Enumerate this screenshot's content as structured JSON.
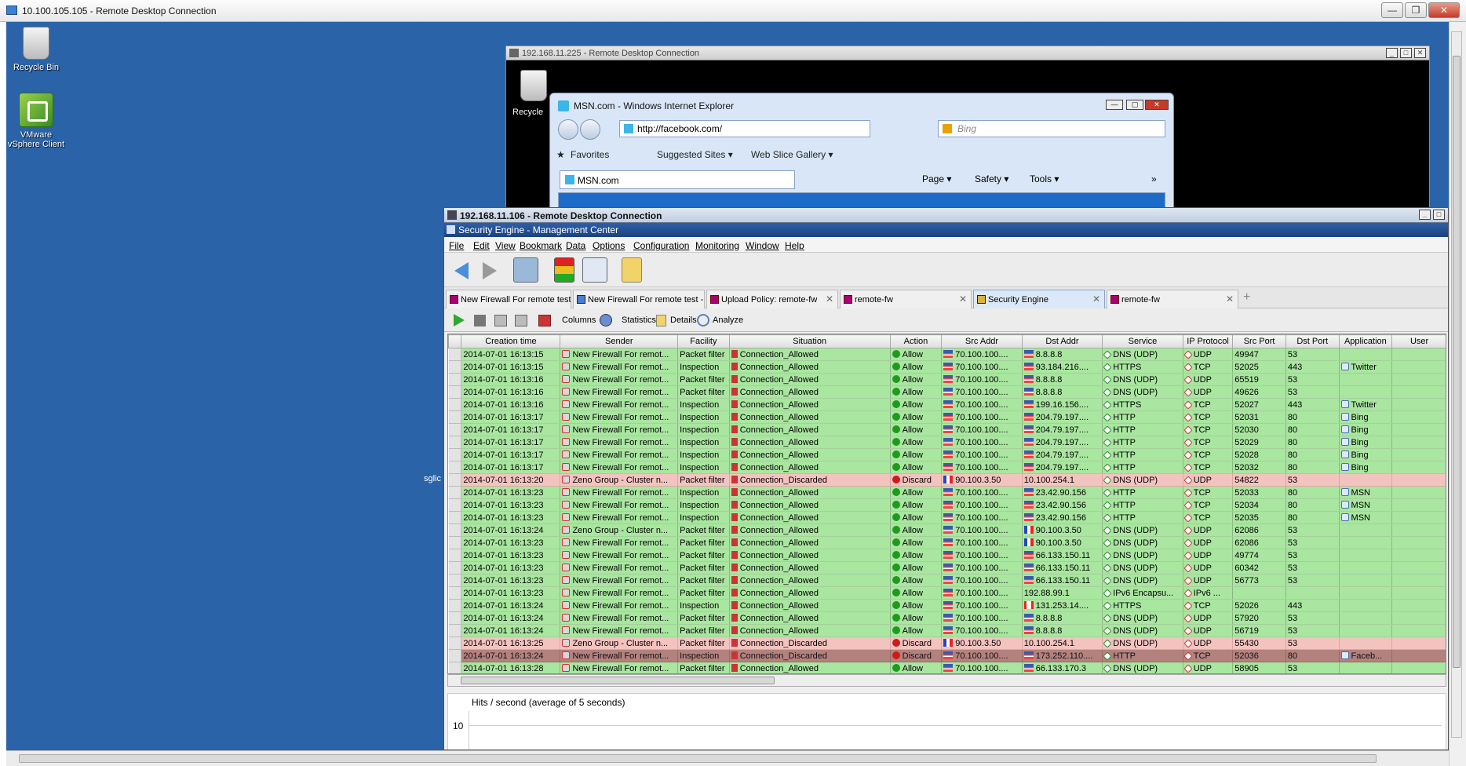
{
  "outer": {
    "title": "10.100.105.105 - Remote Desktop Connection",
    "min": "—",
    "max": "❐",
    "close": "✕"
  },
  "desktop": {
    "icons": [
      {
        "label": "Recycle Bin"
      },
      {
        "label": "VMware vSphere Client"
      }
    ],
    "sglic": "sglic"
  },
  "rdp2": {
    "title": "192.168.11.225 - Remote Desktop Connection",
    "recycle_label": "Recycle"
  },
  "ie": {
    "title": "MSN.com - Windows Internet Explorer",
    "address": "http://facebook.com/",
    "search_placeholder": "Bing",
    "favorites": "Favorites",
    "suggested": "Suggested Sites ▾",
    "webslice": "Web Slice Gallery ▾",
    "tab": "MSN.com",
    "page_menu": "Page ▾",
    "safety_menu": "Safety ▾",
    "tools_menu": "Tools ▾",
    "chevron": "»"
  },
  "rdp3": {
    "title": "192.168.11.106 - Remote Desktop Connection"
  },
  "sem": {
    "title": "Security Engine - Management Center",
    "menus": [
      "File",
      "Edit",
      "View",
      "Bookmark",
      "Data",
      "Options",
      "Configuration",
      "Monitoring",
      "Window",
      "Help"
    ],
    "tabs": [
      {
        "label": "New Firewall For remote test"
      },
      {
        "label": "New Firewall For remote test - ..."
      },
      {
        "label": "Upload Policy: remote-fw"
      },
      {
        "label": "remote-fw"
      },
      {
        "label": "Security Engine"
      },
      {
        "label": "remote-fw"
      }
    ],
    "add_tab": "+",
    "subtools": {
      "columns": "Columns",
      "statistics": "Statistics",
      "details": "Details",
      "analyze": "Analyze"
    },
    "columns": [
      "Creation time",
      "Sender",
      "Facility",
      "Situation",
      "Action",
      "Src Addr",
      "Dst Addr",
      "Service",
      "IP Protocol",
      "Src Port",
      "Dst Port",
      "Application",
      "User"
    ],
    "rows": [
      {
        "type": "allow",
        "time": "2014-07-01 16:13:15",
        "sender": "New Firewall For remot...",
        "facility": "Packet filter",
        "situation": "Connection_Allowed",
        "action": "Allow",
        "src": "70.100.100....",
        "src_flag": "us",
        "dst": "8.8.8.8",
        "dst_flag": "us",
        "service": "DNS (UDP)",
        "proto": "UDP",
        "sport": "49947",
        "dport": "53",
        "app": "",
        "user": ""
      },
      {
        "type": "allow",
        "time": "2014-07-01 16:13:15",
        "sender": "New Firewall For remot...",
        "facility": "Inspection",
        "situation": "Connection_Allowed",
        "action": "Allow",
        "src": "70.100.100....",
        "src_flag": "us",
        "dst": "93.184.216....",
        "dst_flag": "us",
        "service": "HTTPS",
        "proto": "TCP",
        "sport": "52025",
        "dport": "443",
        "app": "Twitter",
        "user": ""
      },
      {
        "type": "allow",
        "time": "2014-07-01 16:13:16",
        "sender": "New Firewall For remot...",
        "facility": "Packet filter",
        "situation": "Connection_Allowed",
        "action": "Allow",
        "src": "70.100.100....",
        "src_flag": "us",
        "dst": "8.8.8.8",
        "dst_flag": "us",
        "service": "DNS (UDP)",
        "proto": "UDP",
        "sport": "65519",
        "dport": "53",
        "app": "",
        "user": ""
      },
      {
        "type": "allow",
        "time": "2014-07-01 16:13:16",
        "sender": "New Firewall For remot...",
        "facility": "Packet filter",
        "situation": "Connection_Allowed",
        "action": "Allow",
        "src": "70.100.100....",
        "src_flag": "us",
        "dst": "8.8.8.8",
        "dst_flag": "us",
        "service": "DNS (UDP)",
        "proto": "UDP",
        "sport": "49626",
        "dport": "53",
        "app": "",
        "user": ""
      },
      {
        "type": "allow",
        "time": "2014-07-01 16:13:16",
        "sender": "New Firewall For remot...",
        "facility": "Inspection",
        "situation": "Connection_Allowed",
        "action": "Allow",
        "src": "70.100.100....",
        "src_flag": "us",
        "dst": "199.16.156....",
        "dst_flag": "us",
        "service": "HTTPS",
        "proto": "TCP",
        "sport": "52027",
        "dport": "443",
        "app": "Twitter",
        "user": ""
      },
      {
        "type": "allow",
        "time": "2014-07-01 16:13:17",
        "sender": "New Firewall For remot...",
        "facility": "Inspection",
        "situation": "Connection_Allowed",
        "action": "Allow",
        "src": "70.100.100....",
        "src_flag": "us",
        "dst": "204.79.197....",
        "dst_flag": "us",
        "service": "HTTP",
        "proto": "TCP",
        "sport": "52031",
        "dport": "80",
        "app": "Bing",
        "user": ""
      },
      {
        "type": "allow",
        "time": "2014-07-01 16:13:17",
        "sender": "New Firewall For remot...",
        "facility": "Inspection",
        "situation": "Connection_Allowed",
        "action": "Allow",
        "src": "70.100.100....",
        "src_flag": "us",
        "dst": "204.79.197....",
        "dst_flag": "us",
        "service": "HTTP",
        "proto": "TCP",
        "sport": "52030",
        "dport": "80",
        "app": "Bing",
        "user": ""
      },
      {
        "type": "allow",
        "time": "2014-07-01 16:13:17",
        "sender": "New Firewall For remot...",
        "facility": "Inspection",
        "situation": "Connection_Allowed",
        "action": "Allow",
        "src": "70.100.100....",
        "src_flag": "us",
        "dst": "204.79.197....",
        "dst_flag": "us",
        "service": "HTTP",
        "proto": "TCP",
        "sport": "52029",
        "dport": "80",
        "app": "Bing",
        "user": ""
      },
      {
        "type": "allow",
        "time": "2014-07-01 16:13:17",
        "sender": "New Firewall For remot...",
        "facility": "Inspection",
        "situation": "Connection_Allowed",
        "action": "Allow",
        "src": "70.100.100....",
        "src_flag": "us",
        "dst": "204.79.197....",
        "dst_flag": "us",
        "service": "HTTP",
        "proto": "TCP",
        "sport": "52028",
        "dport": "80",
        "app": "Bing",
        "user": ""
      },
      {
        "type": "allow",
        "time": "2014-07-01 16:13:17",
        "sender": "New Firewall For remot...",
        "facility": "Inspection",
        "situation": "Connection_Allowed",
        "action": "Allow",
        "src": "70.100.100....",
        "src_flag": "us",
        "dst": "204.79.197....",
        "dst_flag": "us",
        "service": "HTTP",
        "proto": "TCP",
        "sport": "52032",
        "dport": "80",
        "app": "Bing",
        "user": ""
      },
      {
        "type": "discard",
        "time": "2014-07-01 16:13:20",
        "sender": "Zeno Group - Cluster n...",
        "facility": "Packet filter",
        "situation": "Connection_Discarded",
        "action": "Discard",
        "src": "90.100.3.50",
        "src_flag": "fr",
        "dst": "10.100.254.1",
        "dst_flag": "",
        "service": "DNS (UDP)",
        "proto": "UDP",
        "sport": "54822",
        "dport": "53",
        "app": "",
        "user": ""
      },
      {
        "type": "allow",
        "time": "2014-07-01 16:13:23",
        "sender": "New Firewall For remot...",
        "facility": "Inspection",
        "situation": "Connection_Allowed",
        "action": "Allow",
        "src": "70.100.100....",
        "src_flag": "us",
        "dst": "23.42.90.156",
        "dst_flag": "us",
        "service": "HTTP",
        "proto": "TCP",
        "sport": "52033",
        "dport": "80",
        "app": "MSN",
        "user": ""
      },
      {
        "type": "allow",
        "time": "2014-07-01 16:13:23",
        "sender": "New Firewall For remot...",
        "facility": "Inspection",
        "situation": "Connection_Allowed",
        "action": "Allow",
        "src": "70.100.100....",
        "src_flag": "us",
        "dst": "23.42.90.156",
        "dst_flag": "us",
        "service": "HTTP",
        "proto": "TCP",
        "sport": "52034",
        "dport": "80",
        "app": "MSN",
        "user": ""
      },
      {
        "type": "allow",
        "time": "2014-07-01 16:13:23",
        "sender": "New Firewall For remot...",
        "facility": "Inspection",
        "situation": "Connection_Allowed",
        "action": "Allow",
        "src": "70.100.100....",
        "src_flag": "us",
        "dst": "23.42.90.156",
        "dst_flag": "us",
        "service": "HTTP",
        "proto": "TCP",
        "sport": "52035",
        "dport": "80",
        "app": "MSN",
        "user": ""
      },
      {
        "type": "allow",
        "time": "2014-07-01 16:13:24",
        "sender": "Zeno Group - Cluster n...",
        "facility": "Packet filter",
        "situation": "Connection_Allowed",
        "action": "Allow",
        "src": "70.100.100....",
        "src_flag": "us",
        "dst": "90.100.3.50",
        "dst_flag": "fr",
        "service": "DNS (UDP)",
        "proto": "UDP",
        "sport": "62086",
        "dport": "53",
        "app": "",
        "user": ""
      },
      {
        "type": "allow",
        "time": "2014-07-01 16:13:23",
        "sender": "New Firewall For remot...",
        "facility": "Packet filter",
        "situation": "Connection_Allowed",
        "action": "Allow",
        "src": "70.100.100....",
        "src_flag": "us",
        "dst": "90.100.3.50",
        "dst_flag": "fr",
        "service": "DNS (UDP)",
        "proto": "UDP",
        "sport": "62086",
        "dport": "53",
        "app": "",
        "user": ""
      },
      {
        "type": "allow",
        "time": "2014-07-01 16:13:23",
        "sender": "New Firewall For remot...",
        "facility": "Packet filter",
        "situation": "Connection_Allowed",
        "action": "Allow",
        "src": "70.100.100....",
        "src_flag": "us",
        "dst": "66.133.150.11",
        "dst_flag": "us",
        "service": "DNS (UDP)",
        "proto": "UDP",
        "sport": "49774",
        "dport": "53",
        "app": "",
        "user": ""
      },
      {
        "type": "allow",
        "time": "2014-07-01 16:13:23",
        "sender": "New Firewall For remot...",
        "facility": "Packet filter",
        "situation": "Connection_Allowed",
        "action": "Allow",
        "src": "70.100.100....",
        "src_flag": "us",
        "dst": "66.133.150.11",
        "dst_flag": "us",
        "service": "DNS (UDP)",
        "proto": "UDP",
        "sport": "60342",
        "dport": "53",
        "app": "",
        "user": ""
      },
      {
        "type": "allow",
        "time": "2014-07-01 16:13:23",
        "sender": "New Firewall For remot...",
        "facility": "Packet filter",
        "situation": "Connection_Allowed",
        "action": "Allow",
        "src": "70.100.100....",
        "src_flag": "us",
        "dst": "66.133.150.11",
        "dst_flag": "us",
        "service": "DNS (UDP)",
        "proto": "UDP",
        "sport": "56773",
        "dport": "53",
        "app": "",
        "user": ""
      },
      {
        "type": "allow",
        "time": "2014-07-01 16:13:23",
        "sender": "New Firewall For remot...",
        "facility": "Packet filter",
        "situation": "Connection_Allowed",
        "action": "Allow",
        "src": "70.100.100....",
        "src_flag": "us",
        "dst": "192.88.99.1",
        "dst_flag": "",
        "service": "IPv6 Encapsu...",
        "proto": "IPv6 ...",
        "sport": "",
        "dport": "",
        "app": "",
        "user": ""
      },
      {
        "type": "allow",
        "time": "2014-07-01 16:13:24",
        "sender": "New Firewall For remot...",
        "facility": "Inspection",
        "situation": "Connection_Allowed",
        "action": "Allow",
        "src": "70.100.100....",
        "src_flag": "us",
        "dst": "131.253.14....",
        "dst_flag": "ca",
        "service": "HTTPS",
        "proto": "TCP",
        "sport": "52026",
        "dport": "443",
        "app": "",
        "user": ""
      },
      {
        "type": "allow",
        "time": "2014-07-01 16:13:24",
        "sender": "New Firewall For remot...",
        "facility": "Packet filter",
        "situation": "Connection_Allowed",
        "action": "Allow",
        "src": "70.100.100....",
        "src_flag": "us",
        "dst": "8.8.8.8",
        "dst_flag": "us",
        "service": "DNS (UDP)",
        "proto": "UDP",
        "sport": "57920",
        "dport": "53",
        "app": "",
        "user": ""
      },
      {
        "type": "allow",
        "time": "2014-07-01 16:13:24",
        "sender": "New Firewall For remot...",
        "facility": "Packet filter",
        "situation": "Connection_Allowed",
        "action": "Allow",
        "src": "70.100.100....",
        "src_flag": "us",
        "dst": "8.8.8.8",
        "dst_flag": "us",
        "service": "DNS (UDP)",
        "proto": "UDP",
        "sport": "56719",
        "dport": "53",
        "app": "",
        "user": ""
      },
      {
        "type": "discard",
        "time": "2014-07-01 16:13:25",
        "sender": "Zeno Group - Cluster n...",
        "facility": "Packet filter",
        "situation": "Connection_Discarded",
        "action": "Discard",
        "src": "90.100.3.50",
        "src_flag": "fr",
        "dst": "10.100.254.1",
        "dst_flag": "",
        "service": "DNS (UDP)",
        "proto": "UDP",
        "sport": "55430",
        "dport": "53",
        "app": "",
        "user": ""
      },
      {
        "type": "selected",
        "time": "2014-07-01 16:13:24",
        "sender": "New Firewall For remot...",
        "facility": "Inspection",
        "situation": "Connection_Discarded",
        "action": "Discard",
        "src": "70.100.100....",
        "src_flag": "us",
        "dst": "173.252.110....",
        "dst_flag": "us",
        "service": "HTTP",
        "proto": "TCP",
        "sport": "52036",
        "dport": "80",
        "app": "Faceb...",
        "user": ""
      },
      {
        "type": "allow",
        "time": "2014-07-01 16:13:28",
        "sender": "New Firewall For remot...",
        "facility": "Packet filter",
        "situation": "Connection_Allowed",
        "action": "Allow",
        "src": "70.100.100....",
        "src_flag": "us",
        "dst": "66.133.170.3",
        "dst_flag": "us",
        "service": "DNS (UDP)",
        "proto": "UDP",
        "sport": "58905",
        "dport": "53",
        "app": "",
        "user": ""
      }
    ],
    "chart": {
      "title": "Hits / second (average of 5 seconds)",
      "ytick": "10"
    }
  },
  "colors": {
    "allow": "#a9e6a0",
    "discard": "#f3c3c0",
    "selected": "#b4827e",
    "desktop": "#2a63a8"
  }
}
